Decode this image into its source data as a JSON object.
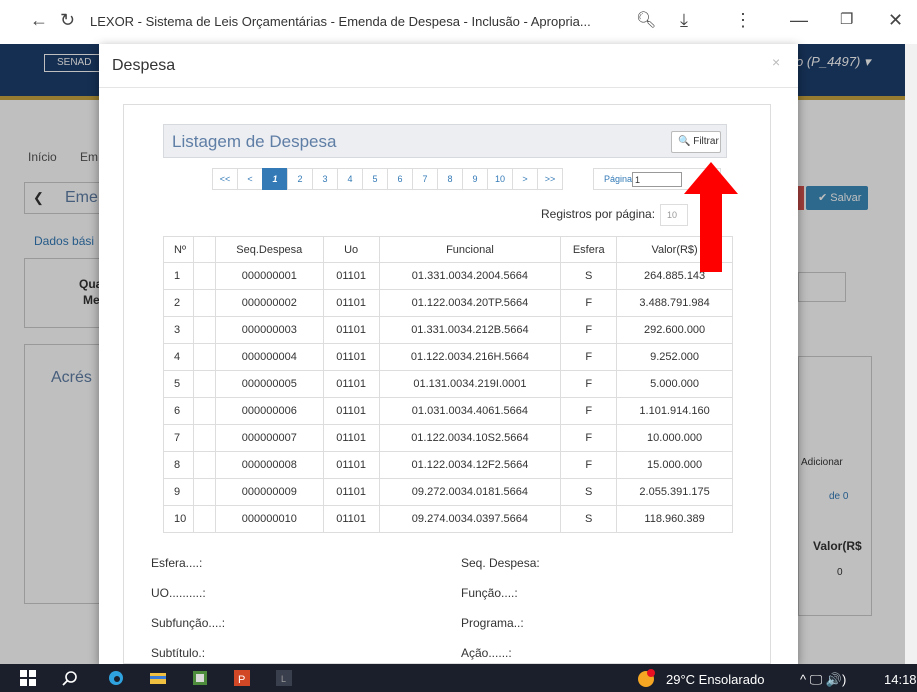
{
  "browser": {
    "title": "LEXOR - Sistema de Leis Orçamentárias - Emenda de Despesa - Inclusão - Apropria..."
  },
  "app": {
    "badge": "SENAD",
    "user": "o (P_4497) ▾",
    "breadcrumb_home": "Início",
    "breadcrumb_next": "Em",
    "back_label": "Eme",
    "tab_dados": "Dados bási",
    "field_qua": "Qua",
    "field_me": "Me",
    "section_acres": "Acrés",
    "salvar": "✔ Salvar",
    "adicionar": "Adicionar",
    "de0": "de 0",
    "valor_col": "Valor(R$",
    "zero": "0"
  },
  "modal": {
    "title": "Despesa",
    "close": "×",
    "panel_title": "Listagem de Despesa",
    "filter_label": "🔍 Filtrar",
    "pager": [
      "<<",
      "<",
      "1",
      "2",
      "3",
      "4",
      "5",
      "6",
      "7",
      "8",
      "9",
      "10",
      ">",
      ">>"
    ],
    "page_label": "Página",
    "page_value": "1",
    "per_page_label": "Registros por página:",
    "per_page_value": "10",
    "columns": [
      "Nº",
      "Seq.Despesa",
      "Uo",
      "Funcional",
      "Esfera",
      "Valor(R$)"
    ],
    "rows": [
      [
        "1",
        "000000001",
        "01101",
        "01.331.0034.2004.5664",
        "S",
        "264.885.143"
      ],
      [
        "2",
        "000000002",
        "01101",
        "01.122.0034.20TP.5664",
        "F",
        "3.488.791.984"
      ],
      [
        "3",
        "000000003",
        "01101",
        "01.331.0034.212B.5664",
        "F",
        "292.600.000"
      ],
      [
        "4",
        "000000004",
        "01101",
        "01.122.0034.216H.5664",
        "F",
        "9.252.000"
      ],
      [
        "5",
        "000000005",
        "01101",
        "01.131.0034.219I.0001",
        "F",
        "5.000.000"
      ],
      [
        "6",
        "000000006",
        "01101",
        "01.031.0034.4061.5664",
        "F",
        "1.101.914.160"
      ],
      [
        "7",
        "000000007",
        "01101",
        "01.122.0034.10S2.5664",
        "F",
        "10.000.000"
      ],
      [
        "8",
        "000000008",
        "01101",
        "01.122.0034.12F2.5664",
        "F",
        "15.000.000"
      ],
      [
        "9",
        "000000009",
        "01101",
        "09.272.0034.0181.5664",
        "S",
        "2.055.391.175"
      ],
      [
        "10",
        "000000010",
        "01101",
        "09.274.0034.0397.5664",
        "S",
        "118.960.389"
      ]
    ],
    "details": {
      "esfera": "Esfera....:",
      "seq_despesa": "Seq. Despesa:",
      "uo": "UO..........:",
      "funcao": "Função....:",
      "subfuncao": "Subfunção....:",
      "programa": "Programa..:",
      "subtitulo": "Subtítulo.:",
      "acao": "Ação......:"
    }
  },
  "taskbar": {
    "weather": "29°C  Ensolarado",
    "time": "14:18",
    "tray": "^ 🖵 🔊)"
  }
}
